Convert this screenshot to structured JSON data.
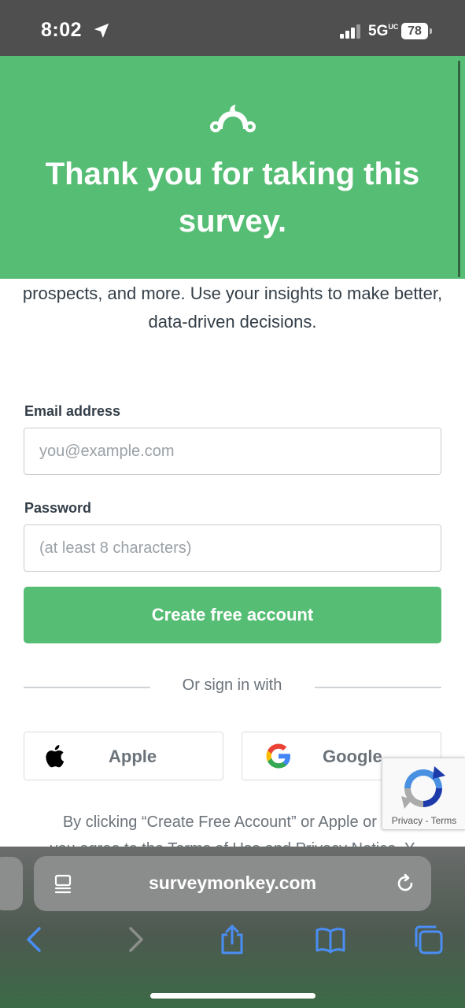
{
  "status_bar": {
    "time": "8:02",
    "network": "5G",
    "network_suffix": "UC",
    "battery": "78"
  },
  "banner": {
    "title": "Thank you for taking this survey.",
    "logo_icon": "surveymonkey-logo-icon",
    "background_color": "#56bd74"
  },
  "intro": {
    "text": "prospects, and more. Use your insights to make better, data-driven decisions."
  },
  "form": {
    "email_label": "Email address",
    "email_placeholder": "you@example.com",
    "email_value": "",
    "password_label": "Password",
    "password_placeholder": "(at least 8 characters)",
    "password_value": "",
    "submit_label": "Create free account"
  },
  "social": {
    "divider_text": "Or sign in with",
    "apple_label": "Apple",
    "google_label": "Google"
  },
  "legal": {
    "line1": "By clicking “Create Free Account” or Apple or Go",
    "line2": "you agree to the Terms of Use and Privacy Notice. Y"
  },
  "recaptcha": {
    "privacy": "Privacy",
    "separator": " - ",
    "terms": "Terms"
  },
  "browser": {
    "url": "surveymonkey.com",
    "icons": [
      "back-icon",
      "forward-icon",
      "share-icon",
      "bookmarks-icon",
      "tabs-icon"
    ]
  }
}
